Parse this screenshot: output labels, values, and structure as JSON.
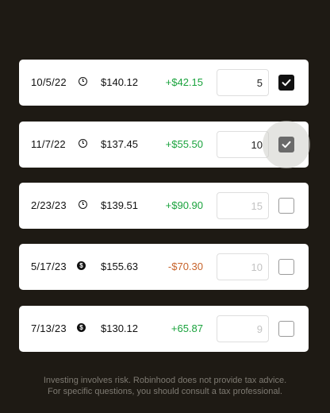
{
  "lots": [
    {
      "date": "10/5/22",
      "icon": "clock-icon",
      "price": "$140.12",
      "gain": "+$42.15",
      "gain_color": "#1aa33d",
      "qty_value": "5",
      "qty_placeholder": "",
      "checked": true
    },
    {
      "date": "11/7/22",
      "icon": "clock-icon",
      "price": "$137.45",
      "gain": "+$55.50",
      "gain_color": "#1aa33d",
      "qty_value": "10",
      "qty_placeholder": "",
      "checked": true,
      "pressed": true
    },
    {
      "date": "2/23/23",
      "icon": "clock-icon",
      "price": "$139.51",
      "gain": "+$90.90",
      "gain_color": "#1aa33d",
      "qty_value": "",
      "qty_placeholder": "15",
      "checked": false
    },
    {
      "date": "5/17/23",
      "icon": "dollar-icon",
      "price": "$155.63",
      "gain": "-$70.30",
      "gain_color": "#c7632a",
      "qty_value": "",
      "qty_placeholder": "10",
      "checked": false
    },
    {
      "date": "7/13/23",
      "icon": "dollar-icon",
      "price": "$130.12",
      "gain": "+65.87",
      "gain_color": "#1aa33d",
      "qty_value": "",
      "qty_placeholder": "9",
      "checked": false
    }
  ],
  "disclaimer": {
    "line1": "Investing involves risk. Robinhood does not provide tax advice.",
    "line2": "For specific questions, you should consult a tax professional."
  },
  "colors": {
    "background": "#1e1a14",
    "card": "#ffffff",
    "gain_positive": "#1aa33d",
    "gain_negative": "#c7632a",
    "checkbox_checked": "#111111"
  }
}
